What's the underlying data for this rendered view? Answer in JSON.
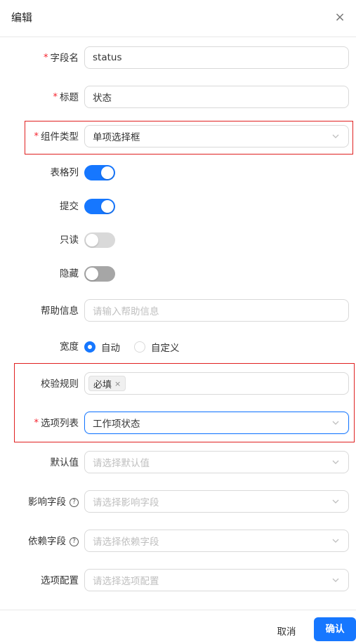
{
  "dialog": {
    "title": "编辑",
    "close_glyph": "×"
  },
  "form": {
    "field_name": {
      "label": "字段名",
      "required": "*",
      "value": "status"
    },
    "title": {
      "label": "标题",
      "required": "*",
      "value": "状态"
    },
    "component_type": {
      "label": "组件类型",
      "required": "*",
      "value": "单项选择框"
    },
    "table_column": {
      "label": "表格列",
      "enabled": true
    },
    "submit": {
      "label": "提交",
      "enabled": true
    },
    "readonly": {
      "label": "只读",
      "enabled": false
    },
    "hidden": {
      "label": "隐藏",
      "enabled": false
    },
    "help_info": {
      "label": "帮助信息",
      "placeholder": "请输入帮助信息"
    },
    "width": {
      "label": "宽度",
      "options": [
        "自动",
        "自定义"
      ],
      "selected": "自动"
    },
    "validation_rules": {
      "label": "校验规则",
      "tags": [
        {
          "text": "必填",
          "remove_glyph": "×"
        }
      ]
    },
    "option_list": {
      "label": "选项列表",
      "required": "*",
      "value": "工作项状态"
    },
    "default_value": {
      "label": "默认值",
      "placeholder": "请选择默认值"
    },
    "affected_fields": {
      "label": "影响字段",
      "help_glyph": "?",
      "placeholder": "请选择影响字段"
    },
    "dependent_fields": {
      "label": "依赖字段",
      "help_glyph": "?",
      "placeholder": "请选择依赖字段"
    },
    "option_config": {
      "label": "选项配置",
      "placeholder": "请选择选项配置"
    }
  },
  "footer": {
    "cancel_label": "取消",
    "confirm_label": "确认"
  },
  "colors": {
    "primary": "#1677ff",
    "required_mark": "#f5222d",
    "highlight_box": "#e02020"
  },
  "icons": [
    "close-icon",
    "chevron-down-icon",
    "question-circle-icon",
    "tag-close-icon"
  ]
}
